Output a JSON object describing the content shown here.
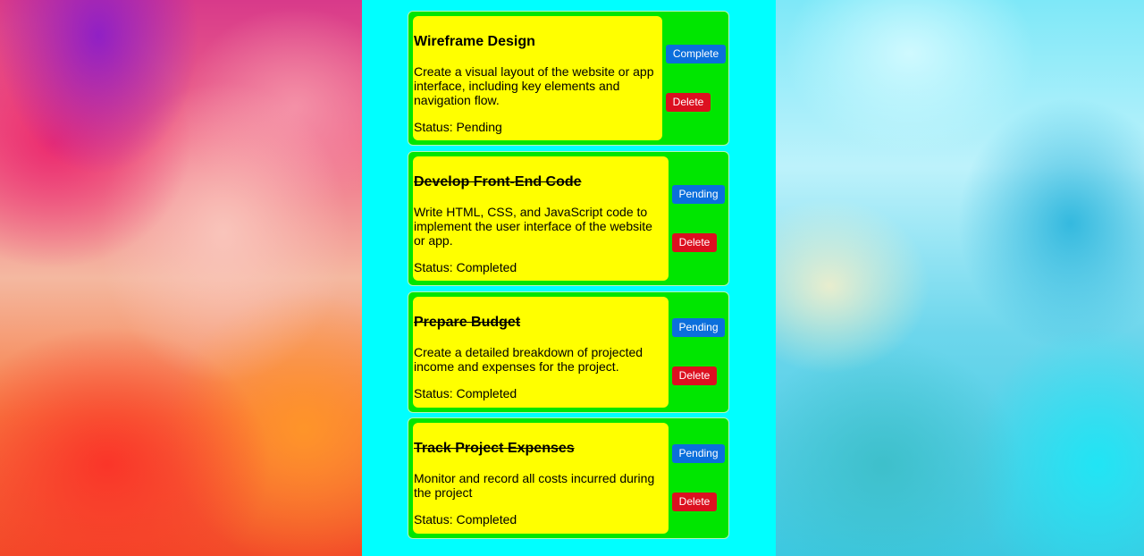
{
  "tasks": [
    {
      "title": "Wireframe Design",
      "description": "Create a visual layout of the website or app interface, including key elements and navigation flow.",
      "status": "Status: Pending",
      "completed": false,
      "toggle_label": "Complete",
      "delete_label": "Delete"
    },
    {
      "title": "Develop Front-End Code",
      "description": "Write HTML, CSS, and JavaScript code to implement the user interface of the website or app.",
      "status": "Status: Completed",
      "completed": true,
      "toggle_label": "Pending",
      "delete_label": "Delete"
    },
    {
      "title": "Prepare Budget",
      "description": "Create a detailed breakdown of projected income and expenses for the project.",
      "status": "Status: Completed",
      "completed": true,
      "toggle_label": "Pending",
      "delete_label": "Delete"
    },
    {
      "title": "Track Project Expenses",
      "description": "Monitor and record all costs incurred during the project",
      "status": "Status: Completed",
      "completed": true,
      "toggle_label": "Pending",
      "delete_label": "Delete"
    }
  ],
  "colors": {
    "card_border_bg": "#00e600",
    "card_body_bg": "#ffff00",
    "column_bg": "#00ffff",
    "toggle_button": "#0b6fdc",
    "delete_button": "#dc1020"
  }
}
